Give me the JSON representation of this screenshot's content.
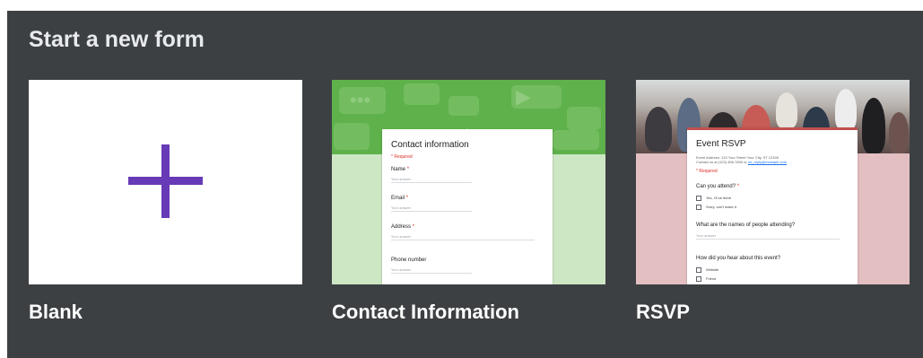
{
  "section": {
    "title": "Start a new form"
  },
  "templates": [
    {
      "label": "Blank"
    },
    {
      "label": "Contact Information",
      "preview": {
        "title": "Contact information",
        "required": "* Required",
        "fields": [
          {
            "label": "Name",
            "placeholder": "Your answer"
          },
          {
            "label": "Email",
            "placeholder": "Your answer"
          },
          {
            "label": "Address",
            "placeholder": "Your answer"
          },
          {
            "label": "Phone number",
            "placeholder": "Your answer"
          }
        ]
      }
    },
    {
      "label": "RSVP",
      "preview": {
        "title": "Event RSVP",
        "details_line1": "Event Address: 123 Your Street Your City, ST 12345",
        "details_line2": "Contact us at (123) 456-7890 or",
        "details_email": "no_reply@example.com",
        "required": "* Required",
        "q1": "Can you attend?",
        "options": [
          "Yes, I'll be there",
          "Sorry, can't make it"
        ],
        "q2": "What are the names of people attending?",
        "q2_placeholder": "Your answer",
        "q3": "How did you hear about this event?",
        "q3_options": [
          "Website",
          "Friend"
        ]
      }
    }
  ],
  "colors": {
    "background": "#3c4043",
    "plus": "#673ab7",
    "contact_header": "#5fb14b",
    "contact_body": "#cde6c4",
    "rsvp_body": "#e3bfc1",
    "rsvp_accent": "#c0514f"
  }
}
